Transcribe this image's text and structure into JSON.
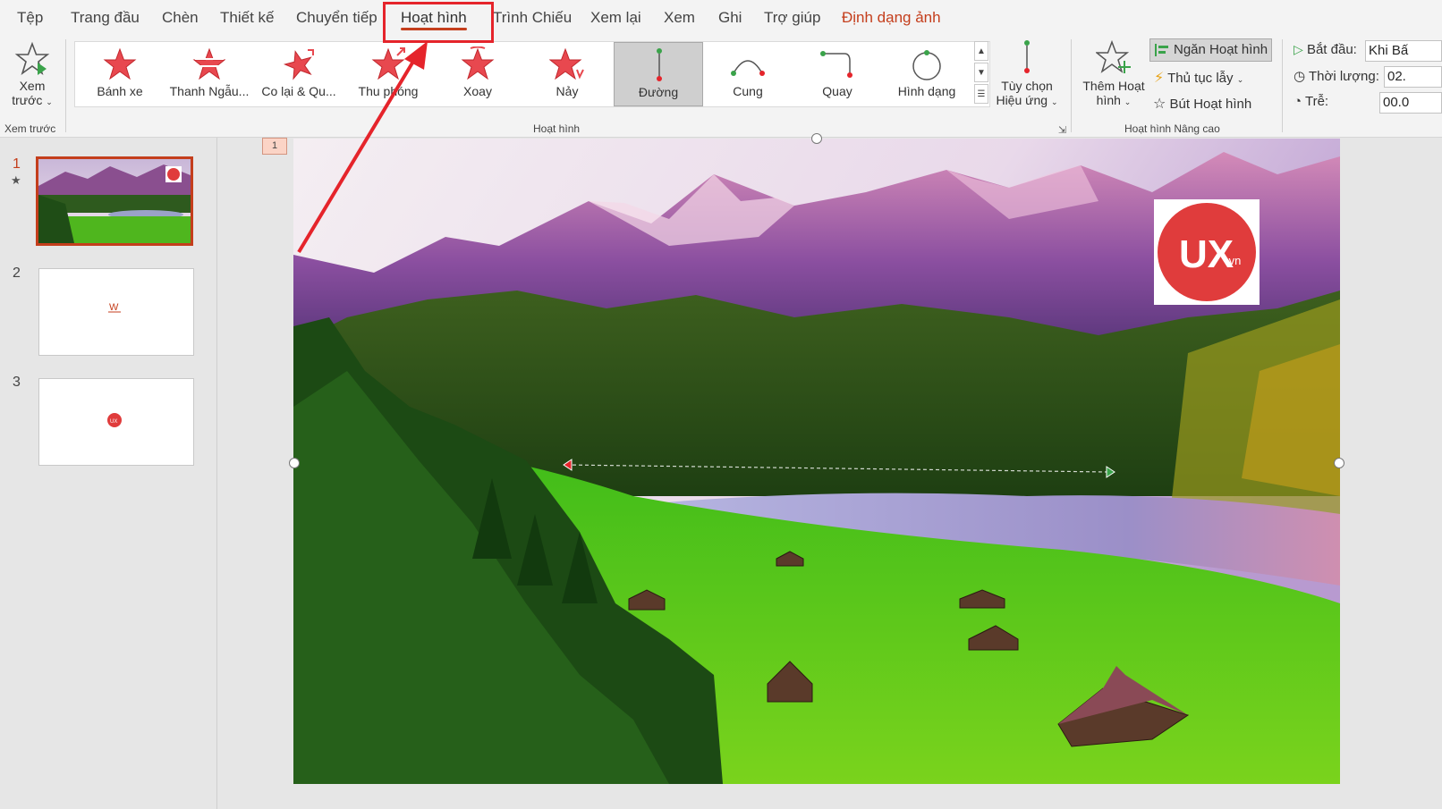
{
  "tabs": [
    "Tệp",
    "Trang đầu",
    "Chèn",
    "Thiết kế",
    "Chuyển tiếp",
    "Hoạt hình",
    "Trình Chiếu",
    "Xem lại",
    "Xem",
    "Ghi",
    "Trợ giúp",
    "Định dạng ảnh"
  ],
  "preview": {
    "label1": "Xem",
    "label2": "trước",
    "group": "Xem trước"
  },
  "gallery": {
    "items": [
      "Bánh xe",
      "Thanh Ngẫu...",
      "Co lại & Qu...",
      "Thu phóng",
      "Xoay",
      "Nảy",
      "Đường",
      "Cung",
      "Quay",
      "Hình dạng"
    ],
    "selected": "Đường",
    "group": "Hoạt hình"
  },
  "effect_options": {
    "label1": "Tùy chọn",
    "label2": "Hiệu ứng"
  },
  "add_animation": {
    "label1": "Thêm Hoạt",
    "label2": "hình"
  },
  "advanced": {
    "stop": "Ngăn Hoạt hình",
    "trigger": "Thủ tục lẫy",
    "painter": "Bút Hoạt hình",
    "group": "Hoạt hình Nâng cao"
  },
  "timing": {
    "start_label": "Bắt đầu:",
    "start_value": "Khi Bấ",
    "duration_label": "Thời lượng:",
    "duration_value": "02.",
    "delay_label": "Trễ:",
    "delay_value": "00.0"
  },
  "slides": [
    {
      "number": "1",
      "star": "★"
    },
    {
      "number": "2"
    },
    {
      "number": "3"
    }
  ],
  "anim_tag": "1",
  "logo": {
    "text": "UX",
    "suffix": ".vn"
  },
  "colors": {
    "accent": "#c43e1c",
    "highlight": "#e5242b",
    "logo_red": "#e03c3c"
  }
}
